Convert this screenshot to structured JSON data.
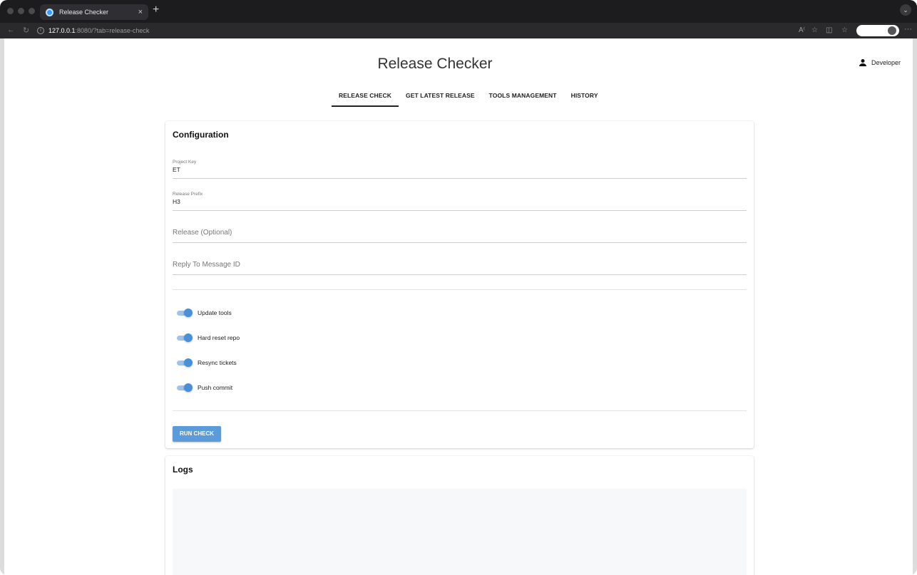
{
  "browser": {
    "tab_title": "Release Checker",
    "tab_close": "×",
    "new_tab": "+",
    "url_host": "127.0.0.1",
    "url_rest": ":8080/?tab=release-check"
  },
  "header": {
    "app_title": "Release Checker",
    "user_label": "Developer"
  },
  "tabs": [
    {
      "label": "RELEASE CHECK",
      "active": true
    },
    {
      "label": "GET LATEST RELEASE",
      "active": false
    },
    {
      "label": "TOOLS MANAGEMENT",
      "active": false
    },
    {
      "label": "HISTORY",
      "active": false
    }
  ],
  "configuration": {
    "title": "Configuration",
    "project_key": {
      "label": "Project Key",
      "value": "ET"
    },
    "release_prefix": {
      "label": "Release Prefix",
      "value": "H3"
    },
    "release": {
      "placeholder": "Release (Optional)"
    },
    "reply_to": {
      "placeholder": "Reply To Message ID"
    },
    "toggles": [
      {
        "label": "Update tools",
        "on": true
      },
      {
        "label": "Hard reset repo",
        "on": true
      },
      {
        "label": "Resync tickets",
        "on": true
      },
      {
        "label": "Push commit",
        "on": true
      }
    ],
    "run_button": "RUN CHECK"
  },
  "logs": {
    "title": "Logs"
  },
  "colors": {
    "accent": "#4a90d9",
    "button": "#5b9bd9"
  }
}
